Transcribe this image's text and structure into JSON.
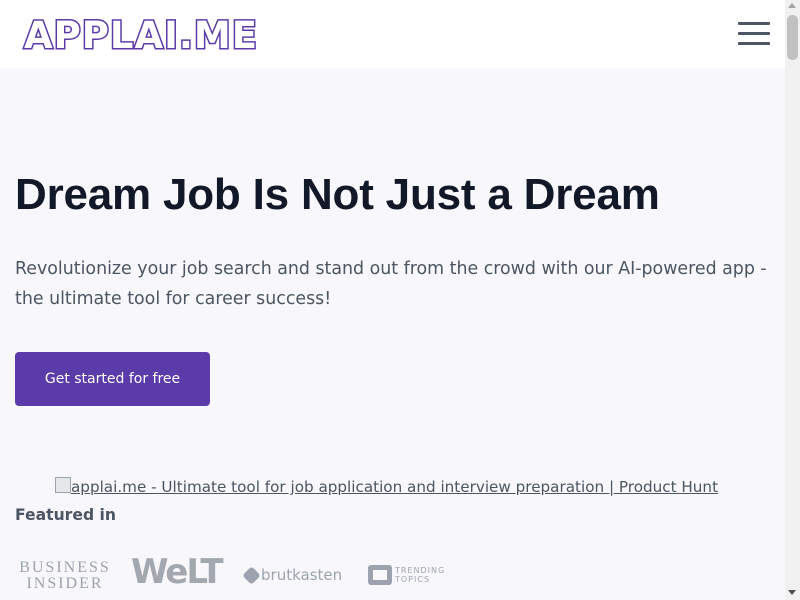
{
  "header": {
    "logo_text": "APPLAI.ME",
    "menu_icon": "hamburger-menu-icon"
  },
  "hero": {
    "title": "Dream Job Is Not Just a Dream",
    "subtitle": "Revolutionize your job search and stand out from the crowd with our AI-powered app - the ultimate tool for career success!",
    "cta_label": "Get started for free"
  },
  "product_hunt": {
    "alt_text": "applai.me - Ultimate tool for job application and interview preparation | Product Hunt"
  },
  "featured": {
    "heading": "Featured in",
    "logos": [
      {
        "name": "BUSINESS INSIDER",
        "line1": "BUSINESS",
        "line2": "INSIDER"
      },
      {
        "name": "WELT",
        "text": "WeLT"
      },
      {
        "name": "brutkasten",
        "text": "brutkasten"
      },
      {
        "name": "TRENDING TOPICS",
        "line1": "TRENDING",
        "line2": "TOPICS"
      }
    ]
  },
  "colors": {
    "brand": "#5b3aa9",
    "heading": "#111827",
    "body_text": "#4b5563",
    "background": "#f8f7fb"
  }
}
